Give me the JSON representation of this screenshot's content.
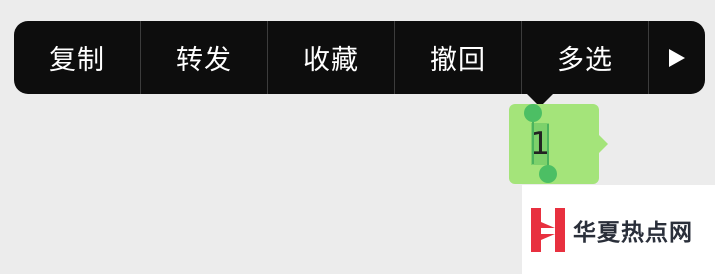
{
  "context_menu": {
    "items": [
      {
        "label": "复制"
      },
      {
        "label": "转发"
      },
      {
        "label": "收藏"
      },
      {
        "label": "撤回"
      },
      {
        "label": "多选"
      }
    ],
    "more_icon": "play-right-triangle-icon"
  },
  "chat": {
    "message_text": "1",
    "bubble_color": "#a4e47a",
    "selection_color": "#7dd16b",
    "handle_color": "#4cbf64"
  },
  "watermark": {
    "text": "华夏热点网",
    "logo_color": "#e8303f"
  }
}
